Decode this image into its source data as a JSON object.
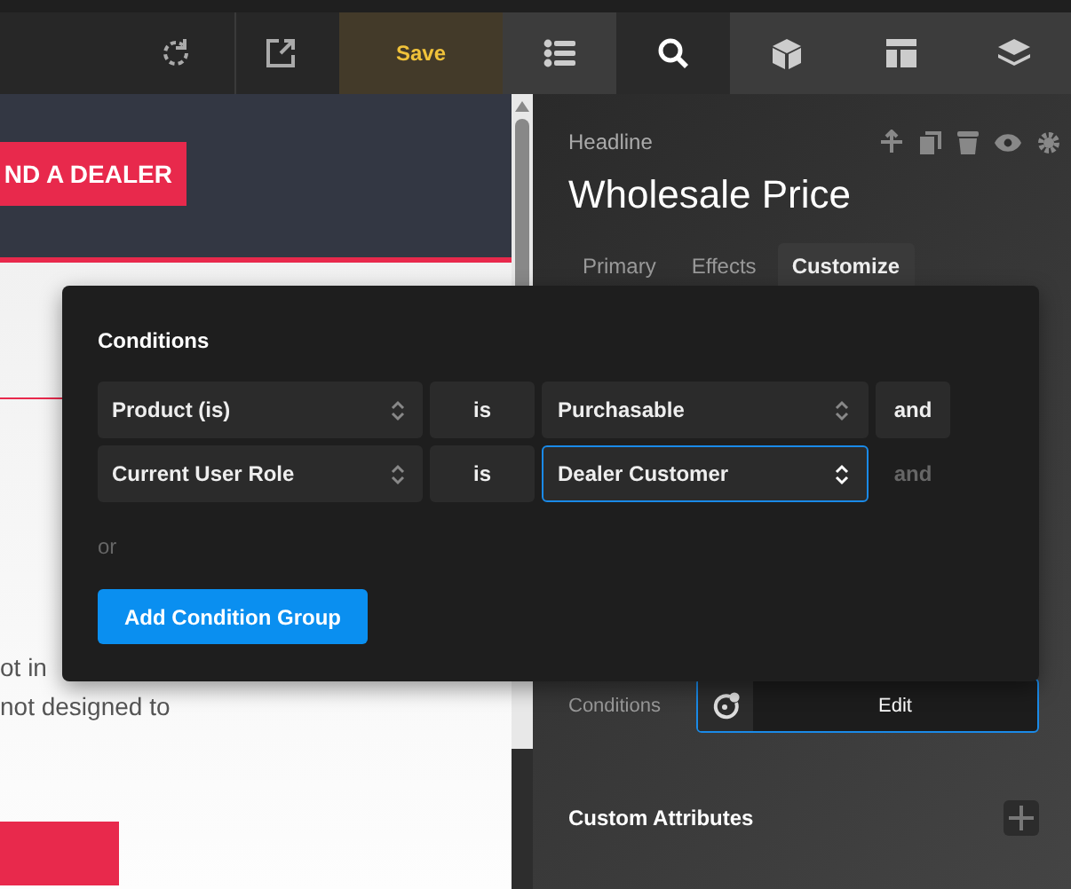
{
  "toolbar": {
    "save_label": "Save",
    "panel_tabs": [
      {
        "kind": "list",
        "selected": false
      },
      {
        "kind": "search",
        "selected": true
      },
      {
        "kind": "box",
        "selected": false
      },
      {
        "kind": "layout",
        "selected": false
      },
      {
        "kind": "layers",
        "selected": false
      }
    ]
  },
  "canvas": {
    "header_button": "ND A DEALER",
    "text_lines": [
      "ot in",
      "not designed to"
    ]
  },
  "panel": {
    "element_type": "Headline",
    "element_name": "Wholesale Price",
    "tabs": [
      {
        "label": "Primary",
        "selected": false
      },
      {
        "label": "Effects",
        "selected": false
      },
      {
        "label": "Customize",
        "selected": true
      }
    ],
    "conditions_label": "Conditions",
    "conditions_button": "Edit",
    "custom_attributes": "Custom Attributes"
  },
  "conditions_popup": {
    "title": "Conditions",
    "rows": [
      {
        "field": "Product (is)",
        "operator": "is",
        "value": "Purchasable",
        "value_focused": false,
        "connector": "and",
        "connector_enabled": true
      },
      {
        "field": "Current User Role",
        "operator": "is",
        "value": "Dealer Customer",
        "value_focused": true,
        "connector": "and",
        "connector_enabled": false
      }
    ],
    "or_label": "or",
    "add_button": "Add Condition Group"
  }
}
